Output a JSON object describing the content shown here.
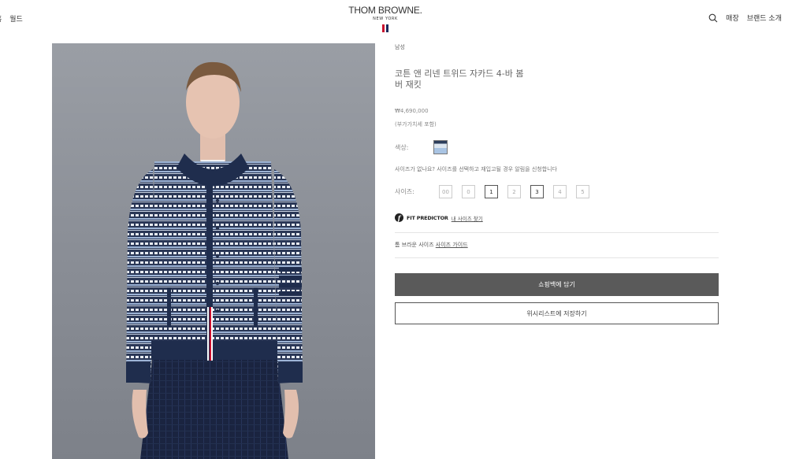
{
  "header": {
    "nav_left": [
      "홈",
      "월드"
    ],
    "logo_main": "THOM BROWNE.",
    "logo_sub": "NEW YORK",
    "nav_right": {
      "store": "매장",
      "about": "브랜드 소개"
    },
    "search_icon": "search-icon"
  },
  "product": {
    "category": "남성",
    "title": "코튼 앤 리넨 트위드 자카드 4-바 봄버 재킷",
    "price": "₩4,690,000",
    "vat_note": "(부가가치세 포함)",
    "color_label": "색상:",
    "size_notice": "사이즈가 없나요? 사이즈를 선택하고 재입고될 경우 알림을 신청합니다",
    "size_label": "사이즈:",
    "sizes": [
      {
        "label": "00",
        "available": false
      },
      {
        "label": "0",
        "available": false
      },
      {
        "label": "1",
        "available": true
      },
      {
        "label": "2",
        "available": false
      },
      {
        "label": "3",
        "available": true
      },
      {
        "label": "4",
        "available": false
      },
      {
        "label": "5",
        "available": false
      }
    ],
    "fit_predictor_label": "FIT PREDICTOR",
    "fit_predictor_link": "내 사이즈 찾기",
    "size_guide_prefix": "톰 브라운 사이즈",
    "size_guide_link": "사이즈 가이드",
    "add_to_bag": "쇼핑백에 담기",
    "add_to_wishlist": "위시리스트에 저장하기"
  },
  "colors": {
    "flag_red": "#c8102e",
    "flag_white": "#ffffff",
    "flag_blue": "#1b2a5c",
    "cart_button": "#5a5a5a",
    "image_background": "#8a8e96",
    "jacket_navy": "#1f2d4d"
  }
}
